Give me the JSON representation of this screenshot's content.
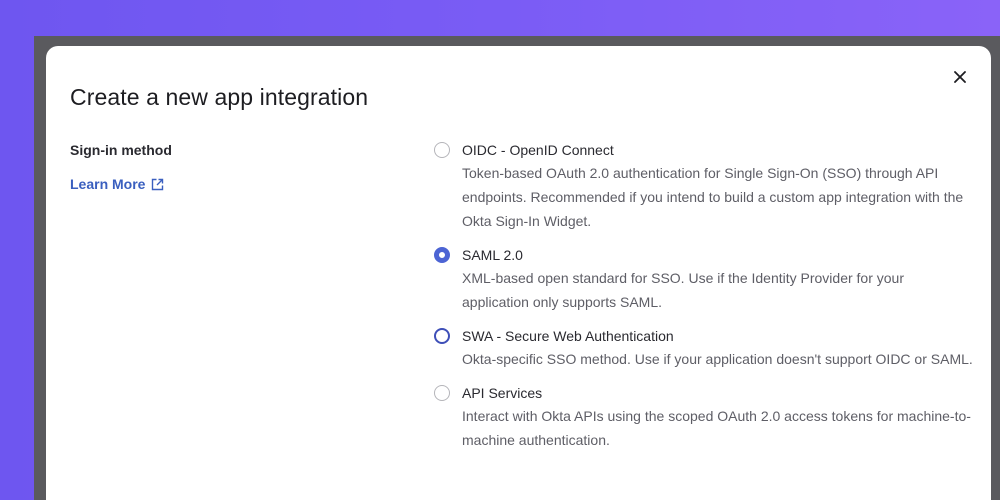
{
  "modal": {
    "title": "Create a new app integration",
    "close_label": "×"
  },
  "sign_in": {
    "label": "Sign-in method",
    "learn_more": "Learn More"
  },
  "options": [
    {
      "title": "OIDC - OpenID Connect",
      "description": "Token-based OAuth 2.0 authentication for Single Sign-On (SSO) through API endpoints. Recommended if you intend to build a custom app integration with the Okta Sign-In Widget.",
      "selected": false
    },
    {
      "title": "SAML 2.0",
      "description": "XML-based open standard for SSO. Use if the Identity Provider for your application only supports SAML.",
      "selected": true
    },
    {
      "title": "SWA - Secure Web Authentication",
      "description": "Okta-specific SSO method. Use if your application doesn't support OIDC or SAML.",
      "selected": false
    },
    {
      "title": "API Services",
      "description": "Interact with Okta APIs using the scoped OAuth 2.0 access tokens for machine-to-machine authentication.",
      "selected": false
    }
  ],
  "colors": {
    "accent": "#4c64d4",
    "link": "#3a5fbf",
    "background": "#7a5cf5"
  },
  "icons": {
    "close": "close-icon",
    "external_link": "external-link-icon"
  }
}
